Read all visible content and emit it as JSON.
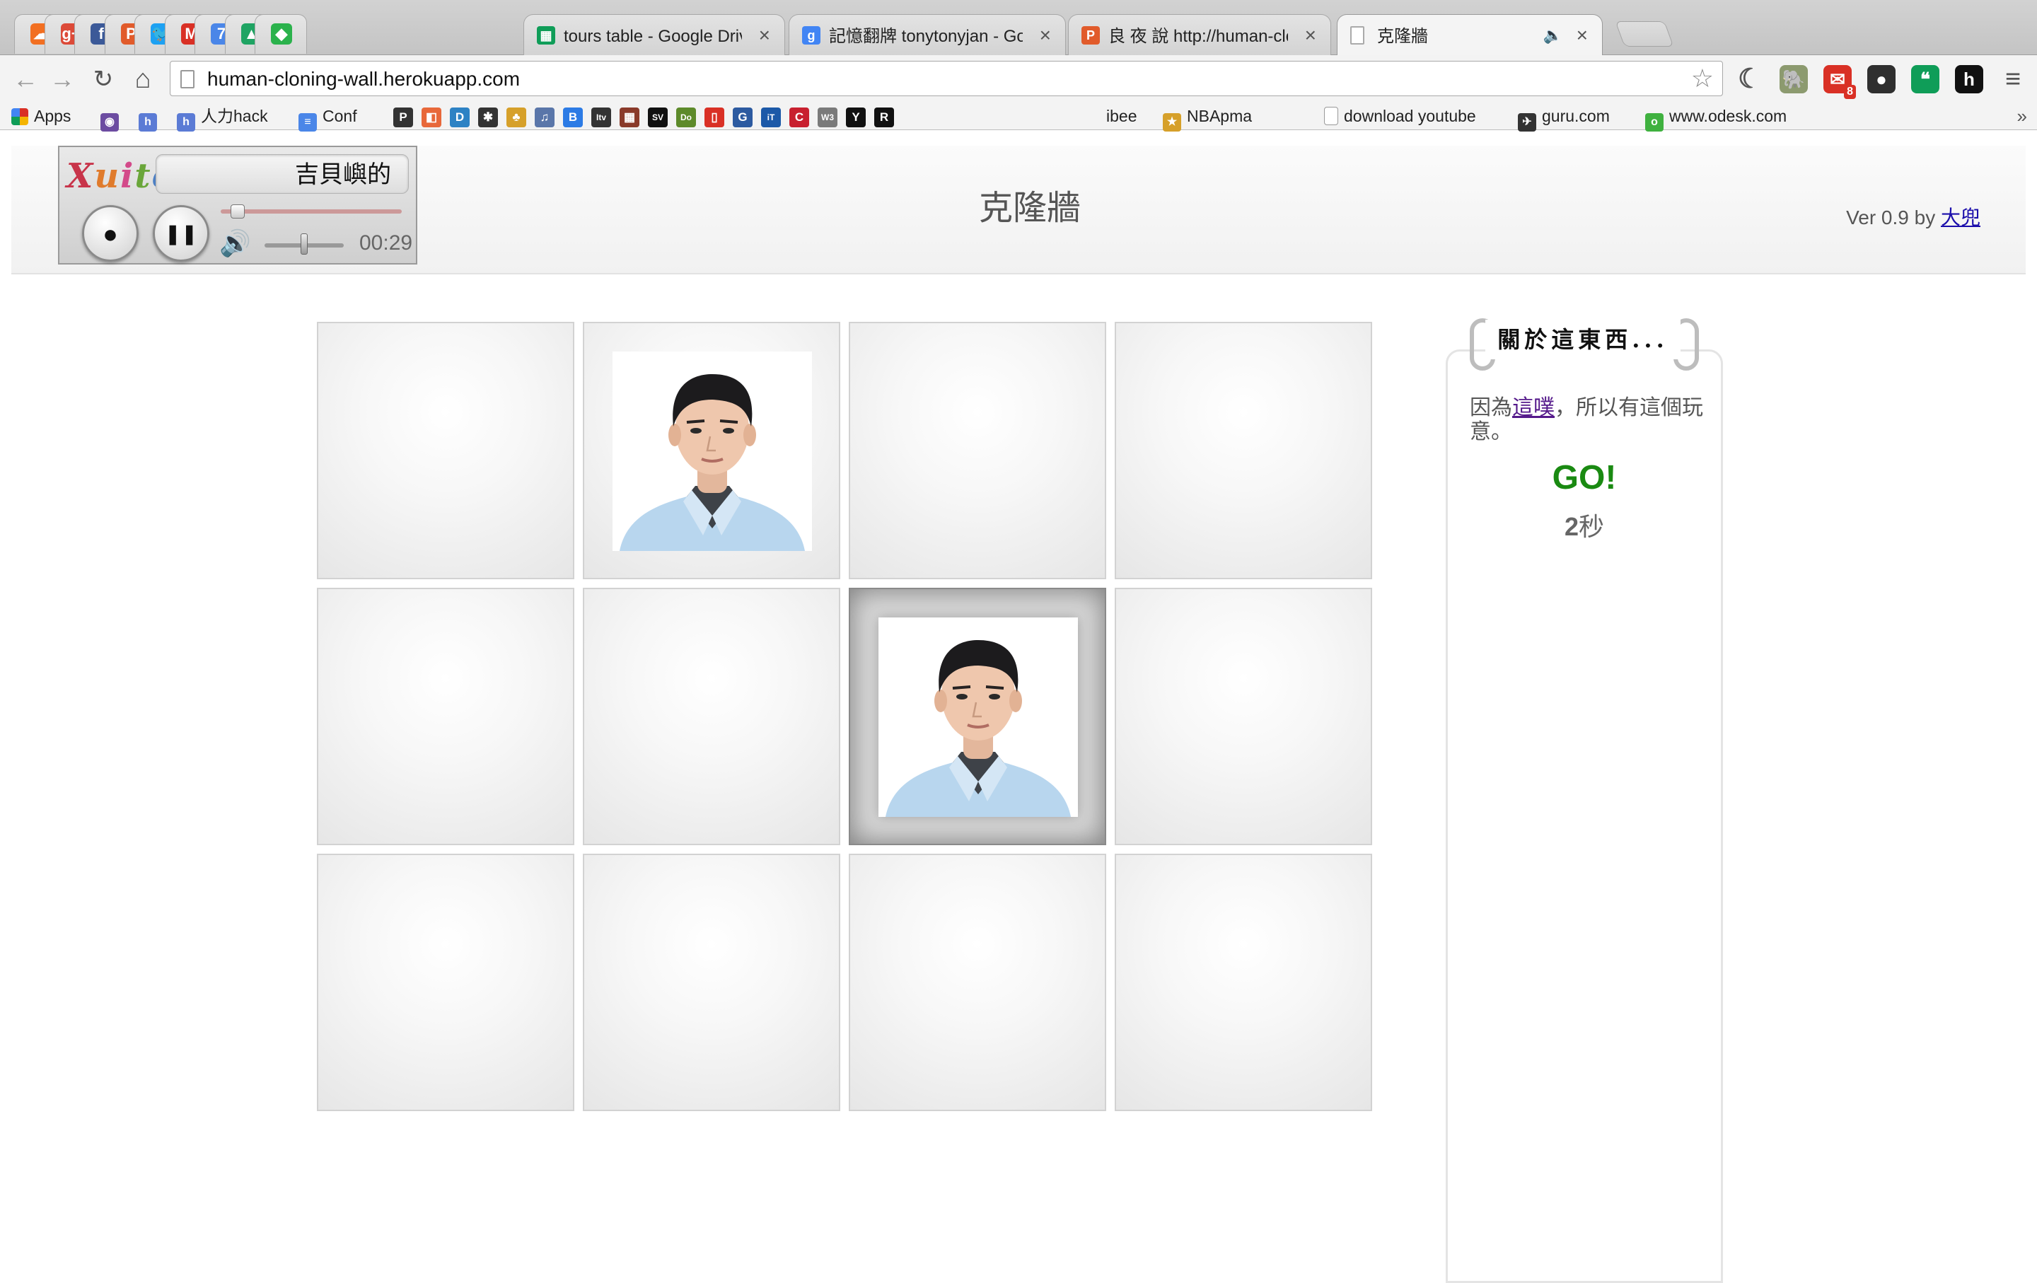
{
  "browser": {
    "pinned_tabs": [
      {
        "icon": "soundcloud-icon",
        "glyph": "☁",
        "color": "#f26f21"
      },
      {
        "icon": "google-plus-icon",
        "glyph": "g+",
        "color": "#dc4a38"
      },
      {
        "icon": "facebook-icon",
        "glyph": "f",
        "color": "#3b5998"
      },
      {
        "icon": "prezi-icon",
        "glyph": "P",
        "color": "#e15b2b"
      },
      {
        "icon": "twitter-icon",
        "glyph": "🐦",
        "color": "#1da1f2"
      },
      {
        "icon": "gmail-icon",
        "glyph": "M",
        "color": "#d93025"
      },
      {
        "icon": "calendar-icon",
        "glyph": "7",
        "color": "#4a86e8"
      },
      {
        "icon": "google-drive-icon",
        "glyph": "▲",
        "color": "#1fa463"
      },
      {
        "icon": "feedly-icon",
        "glyph": "◆",
        "color": "#2bb24c"
      }
    ],
    "tabs": [
      {
        "title": "tours table - Google Drive",
        "icon": "sheets-icon",
        "glyph": "▦",
        "color": "#0f9d58"
      },
      {
        "title": "記憶翻牌 tonytonyjan - Goo",
        "icon": "google-search-icon",
        "glyph": "g",
        "color": "#4285f4"
      },
      {
        "title": "良 夜 說 http://human-clon",
        "icon": "prezi-icon",
        "glyph": "P",
        "color": "#e15b2b"
      },
      {
        "title": "克隆牆",
        "icon": "page-icon",
        "glyph": "",
        "color": "#ffffff",
        "active": true,
        "sound": "🔈"
      }
    ],
    "close_glyph": "×",
    "url": "human-cloning-wall.herokuapp.com",
    "nav": {
      "back": "←",
      "forward": "→",
      "reload": "↻",
      "home": "⌂",
      "star": "☆"
    },
    "extensions": [
      {
        "icon": "moon-icon",
        "glyph": "☾",
        "color": "#555555"
      },
      {
        "icon": "evernote-icon",
        "glyph": "🐘",
        "color": "#8c9a6f"
      },
      {
        "icon": "gmail-checker-icon",
        "glyph": "✉",
        "color": "#d93025",
        "badge": "8"
      },
      {
        "icon": "green-circle-icon",
        "glyph": "●",
        "color": "#2f2f2f"
      },
      {
        "icon": "hangouts-icon",
        "glyph": "❝",
        "color": "#0f9d58"
      },
      {
        "icon": "h-icon",
        "glyph": "h",
        "color": "#111111"
      },
      {
        "icon": "menu-icon",
        "glyph": "≡",
        "color": "#555555"
      }
    ],
    "bookmarks": {
      "apps_label": "Apps",
      "items": [
        {
          "label": "",
          "icon": "purple-globe-icon",
          "glyph": "◉",
          "color": "#6c4ca1"
        },
        {
          "label": "",
          "icon": "h-blue-icon",
          "glyph": "h",
          "color": "#5b7bd5"
        },
        {
          "label": "人力hack",
          "icon": "h-blue-icon",
          "glyph": "h",
          "color": "#5b7bd5"
        },
        {
          "label": "Conf",
          "icon": "doc-icon",
          "glyph": "≡",
          "color": "#4a86e8"
        },
        {
          "label": "ibee",
          "icon": "",
          "glyph": "",
          "color": ""
        },
        {
          "label": "NBApma",
          "icon": "nbapma-icon",
          "glyph": "★",
          "color": "#d6a02a"
        },
        {
          "label": "download youtube",
          "icon": "file-icon",
          "glyph": "",
          "color": "#ffffff"
        },
        {
          "label": "guru.com",
          "icon": "guru-icon",
          "glyph": "✈",
          "color": "#333333"
        },
        {
          "label": "www.odesk.com",
          "icon": "odesk-icon",
          "glyph": "o",
          "color": "#3fb13f"
        }
      ],
      "small_icons": [
        {
          "icon": "p-icon",
          "glyph": "P",
          "color": "#333333"
        },
        {
          "icon": "colorful-icon",
          "glyph": "◧",
          "color": "#e8683a"
        },
        {
          "icon": "d-blue-icon",
          "glyph": "D",
          "color": "#2d82c4"
        },
        {
          "icon": "bug-icon",
          "glyph": "✱",
          "color": "#333333"
        },
        {
          "icon": "bird-icon",
          "glyph": "♣",
          "color": "#d6a02a"
        },
        {
          "icon": "music-icon",
          "glyph": "♫",
          "color": "#5a76a9"
        },
        {
          "icon": "b-blue-icon",
          "glyph": "B",
          "color": "#2c7be5"
        },
        {
          "icon": "itv-icon",
          "glyph": "Itv",
          "color": "#333333"
        },
        {
          "icon": "building-icon",
          "glyph": "▦",
          "color": "#8a3a2a"
        },
        {
          "icon": "sv-icon",
          "glyph": "SV",
          "color": "#111111"
        },
        {
          "icon": "do-icon",
          "glyph": "Do",
          "color": "#5d8a2a"
        },
        {
          "icon": "red-rect-icon",
          "glyph": "▯",
          "color": "#d93025"
        },
        {
          "icon": "g-blue-icon",
          "glyph": "G",
          "color": "#2c5aa0"
        },
        {
          "icon": "it-icon",
          "glyph": "iT",
          "color": "#1c59a8"
        },
        {
          "icon": "c-red-icon",
          "glyph": "C",
          "color": "#c8202f"
        },
        {
          "icon": "w3-icon",
          "glyph": "W3",
          "color": "#7a7a7a"
        },
        {
          "icon": "yh-icon",
          "glyph": "Y",
          "color": "#111111"
        },
        {
          "icon": "r-icon",
          "glyph": "R",
          "color": "#111111"
        }
      ],
      "more": "»"
    }
  },
  "player": {
    "logo_letters": [
      "X",
      "u",
      "i",
      "t",
      "e"
    ],
    "song_title": "吉貝嶼的",
    "user_glyph": "●",
    "pause_glyph": "❚❚",
    "volume_glyph": "🔊",
    "time": "00:29",
    "progress": 0.07,
    "volume": 0.5
  },
  "page": {
    "title": "克隆牆",
    "version_prefix": "Ver 0.9 by ",
    "author": "大兜"
  },
  "grid": {
    "rows": 3,
    "cols": 4,
    "cells": [
      {
        "revealed": false
      },
      {
        "revealed": true
      },
      {
        "revealed": false
      },
      {
        "revealed": false
      },
      {
        "revealed": false
      },
      {
        "revealed": false
      },
      {
        "revealed": true,
        "selected": true
      },
      {
        "revealed": false
      },
      {
        "revealed": false
      },
      {
        "revealed": false
      },
      {
        "revealed": false
      },
      {
        "revealed": false
      }
    ]
  },
  "sidebar": {
    "heading": "關於這東西...",
    "desc_prefix": "因為",
    "desc_link": "這噗",
    "desc_suffix": "，所以有這個玩意。",
    "go": "GO!",
    "timer_value": "2",
    "timer_unit": "秒"
  },
  "colors": {
    "go": "#1a8a12",
    "link": "#1a0dab",
    "visited_link": "#551a8b"
  }
}
